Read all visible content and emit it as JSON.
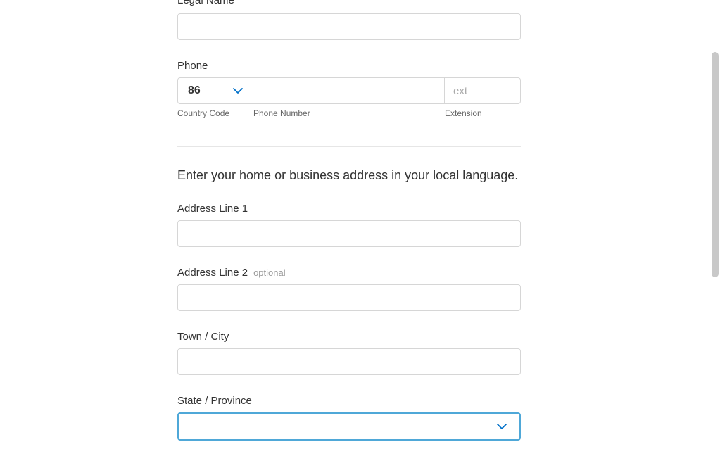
{
  "form": {
    "legalName": {
      "label": "Legal Name",
      "value": ""
    },
    "phone": {
      "label": "Phone",
      "countryCode": {
        "value": "86",
        "sublabel": "Country Code"
      },
      "number": {
        "value": "",
        "sublabel": "Phone Number"
      },
      "extension": {
        "value": "",
        "placeholder": "ext",
        "sublabel": "Extension"
      }
    },
    "addressSection": {
      "heading": "Enter your home or business address in your local language."
    },
    "addressLine1": {
      "label": "Address Line 1",
      "value": ""
    },
    "addressLine2": {
      "label": "Address Line 2",
      "optional": "optional",
      "value": ""
    },
    "townCity": {
      "label": "Town / City",
      "value": ""
    },
    "stateProvince": {
      "label": "State / Province",
      "value": ""
    }
  }
}
